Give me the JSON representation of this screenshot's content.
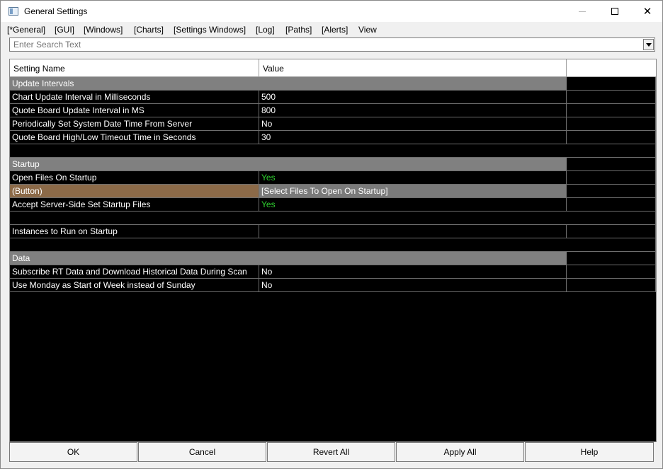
{
  "window": {
    "title": "General Settings"
  },
  "menu": [
    "[*General]",
    "[GUI]",
    "[Windows]",
    "[Charts]",
    "[Settings Windows]",
    "[Log]",
    "[Paths]",
    "[Alerts]",
    "View"
  ],
  "search": {
    "placeholder": "Enter Search Text"
  },
  "grid": {
    "headers": {
      "name": "Setting Name",
      "value": "Value",
      "extra": ""
    },
    "groups": [
      {
        "title": "Update Intervals",
        "rows": [
          {
            "name": "Chart Update Interval in Milliseconds",
            "value": "500"
          },
          {
            "name": "Quote Board Update Interval in MS",
            "value": "800"
          },
          {
            "name": "Periodically Set System Date Time From Server",
            "value": "No"
          },
          {
            "name": "Quote Board High/Low Timeout Time in Seconds",
            "value": "30"
          }
        ]
      },
      {
        "title": "Startup",
        "rows": [
          {
            "name": "Open Files On Startup",
            "value": "Yes"
          },
          {
            "name": " (Button)",
            "value": "[Select Files To Open On Startup]"
          },
          {
            "name": "Accept Server-Side Set Startup Files",
            "value": "Yes"
          },
          {
            "name": "",
            "value": ""
          },
          {
            "name": "Instances to Run on Startup",
            "value": ""
          }
        ]
      },
      {
        "title": "Data",
        "rows": [
          {
            "name": "Subscribe RT Data and Download Historical Data During Scan",
            "value": "No"
          },
          {
            "name": "Use Monday as Start of Week instead of Sunday",
            "value": "No"
          }
        ]
      }
    ]
  },
  "footer": {
    "ok": "OK",
    "cancel": "Cancel",
    "revert_all": "Revert All",
    "apply_all": "Apply All",
    "help": "Help"
  },
  "colors": {
    "group_bg": "#808080",
    "yes_green": "#2fd12f",
    "button_row": "#8c6a48",
    "grid_bg": "#000000"
  }
}
